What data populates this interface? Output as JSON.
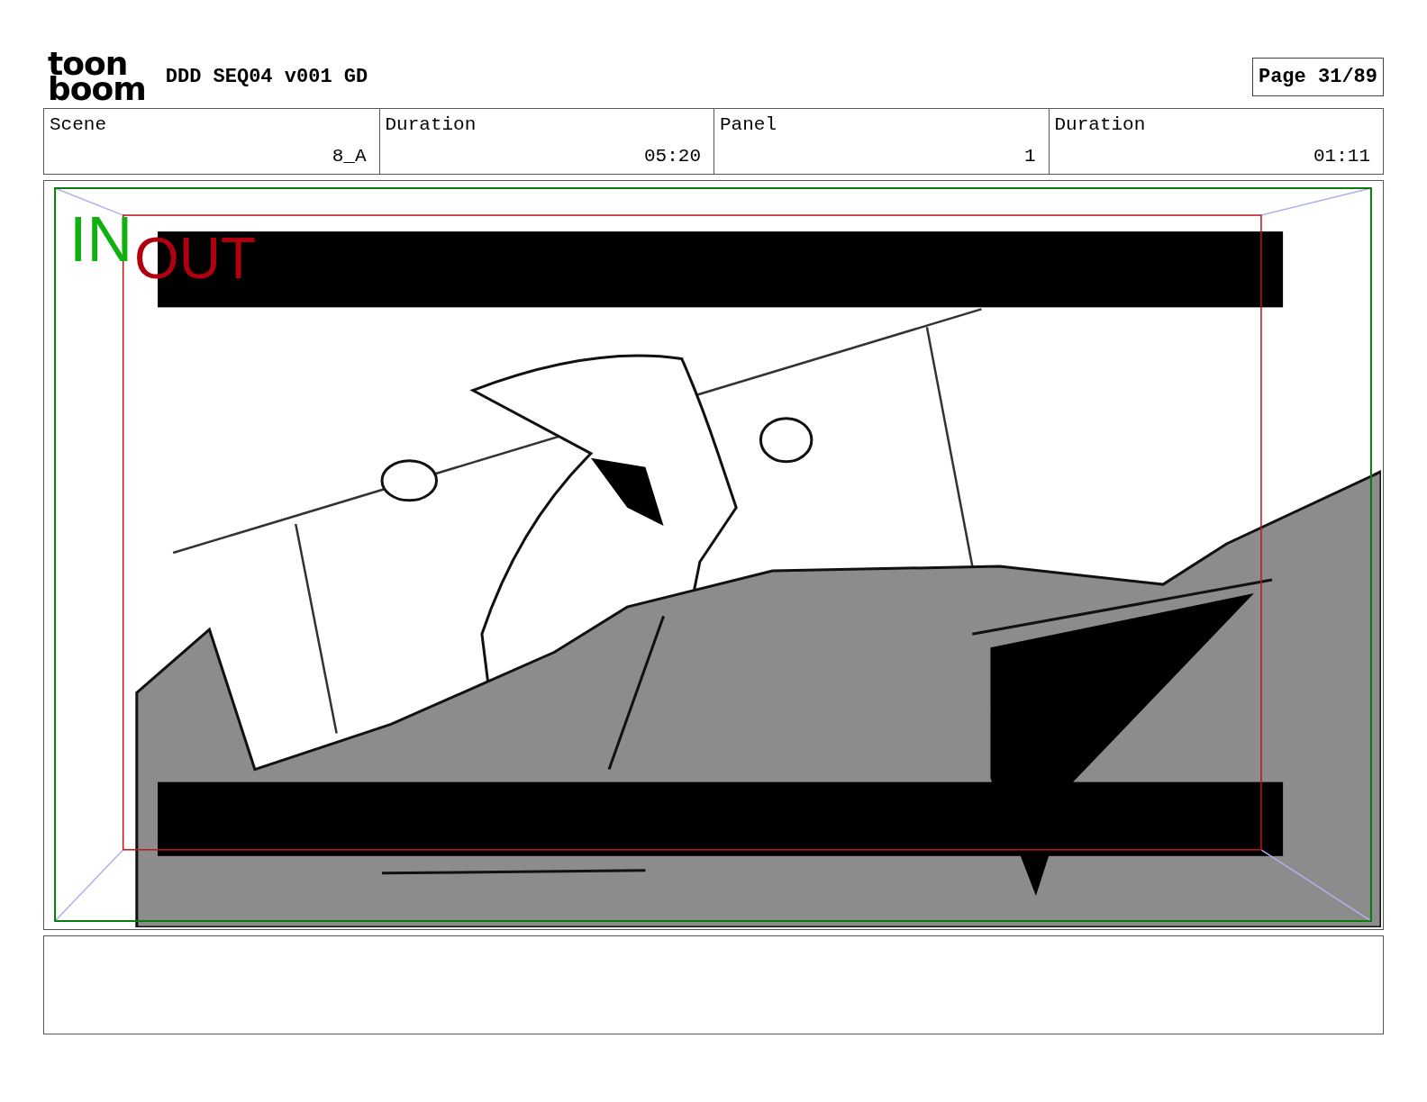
{
  "header": {
    "logo": [
      "toon",
      "boom"
    ],
    "title": "DDD SEQ04 v001 GD",
    "page": "Page 31/89"
  },
  "fields": [
    {
      "label": "Scene",
      "value": "8_A"
    },
    {
      "label": "Duration",
      "value": "05:20"
    },
    {
      "label": "Panel",
      "value": "1"
    },
    {
      "label": "Duration",
      "value": "01:11"
    }
  ],
  "panel": {
    "in_label": "IN",
    "out_label": "OUT"
  }
}
